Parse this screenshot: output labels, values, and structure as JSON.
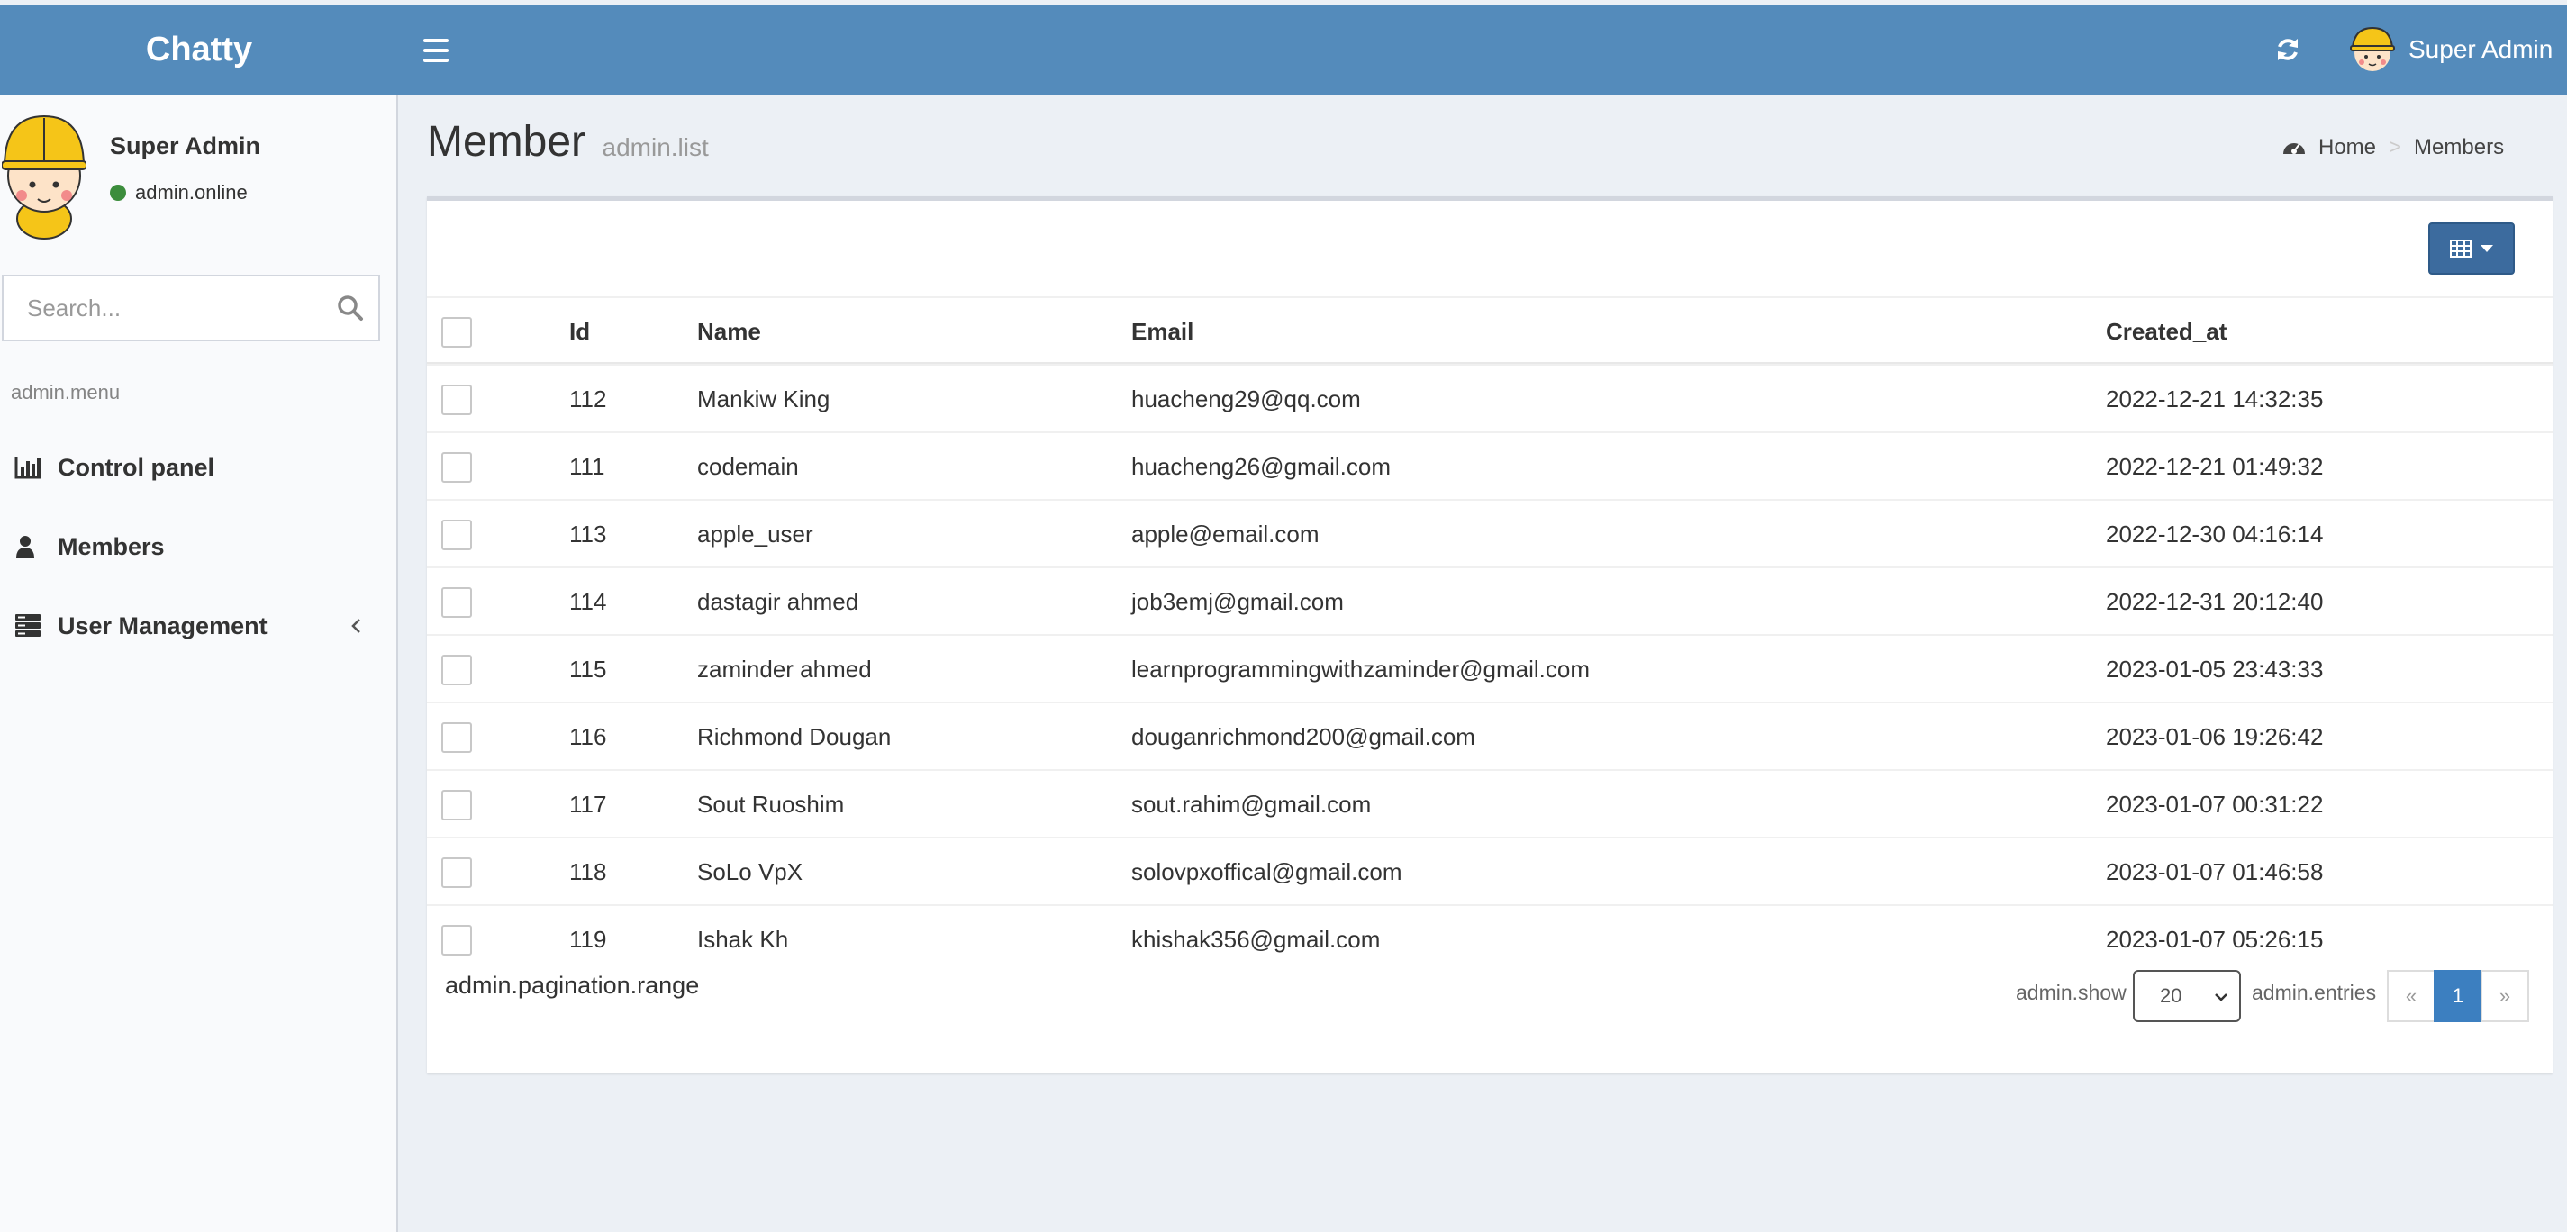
{
  "app": {
    "title": "Chatty"
  },
  "header": {
    "user_name": "Super Admin"
  },
  "sidebar": {
    "user_name": "Super Admin",
    "status": "admin.online",
    "search_placeholder": "Search...",
    "menu_header": "admin.menu",
    "items": [
      {
        "label": "Control panel",
        "icon": "bar-chart-icon"
      },
      {
        "label": "Members",
        "icon": "user-icon"
      },
      {
        "label": "User Management",
        "icon": "server-icon"
      }
    ]
  },
  "page": {
    "title": "Member",
    "subtitle": "admin.list",
    "breadcrumb": {
      "home": "Home",
      "current": "Members"
    }
  },
  "table": {
    "headers": {
      "id": "Id",
      "name": "Name",
      "email": "Email",
      "created_at": "Created_at"
    },
    "rows": [
      {
        "id": "112",
        "name": "Mankiw King",
        "email": "huacheng29@qq.com",
        "created_at": "2022-12-21 14:32:35"
      },
      {
        "id": "111",
        "name": "codemain",
        "email": "huacheng26@gmail.com",
        "created_at": "2022-12-21 01:49:32"
      },
      {
        "id": "113",
        "name": "apple_user",
        "email": "apple@email.com",
        "created_at": "2022-12-30 04:16:14"
      },
      {
        "id": "114",
        "name": "dastagir ahmed",
        "email": "job3emj@gmail.com",
        "created_at": "2022-12-31 20:12:40"
      },
      {
        "id": "115",
        "name": "zaminder ahmed",
        "email": "learnprogrammingwithzaminder@gmail.com",
        "created_at": "2023-01-05 23:43:33"
      },
      {
        "id": "116",
        "name": "Richmond Dougan",
        "email": "douganrichmond200@gmail.com",
        "created_at": "2023-01-06 19:26:42"
      },
      {
        "id": "117",
        "name": "Sout Ruoshim",
        "email": "sout.rahim@gmail.com",
        "created_at": "2023-01-07 00:31:22"
      },
      {
        "id": "118",
        "name": "SoLo VpX",
        "email": "solovpxoffical@gmail.com",
        "created_at": "2023-01-07 01:46:58"
      },
      {
        "id": "119",
        "name": "Ishak Kh",
        "email": "khishak356@gmail.com",
        "created_at": "2023-01-07 05:26:15"
      }
    ]
  },
  "footer": {
    "range": "admin.pagination.range",
    "show": "admin.show",
    "per_page": "20",
    "entries": "admin.entries",
    "pages": {
      "prev": "«",
      "current": "1",
      "next": "»"
    }
  },
  "colors": {
    "header": "#548bbb",
    "accent": "#3c7fc0",
    "online": "#3c8d3c"
  }
}
